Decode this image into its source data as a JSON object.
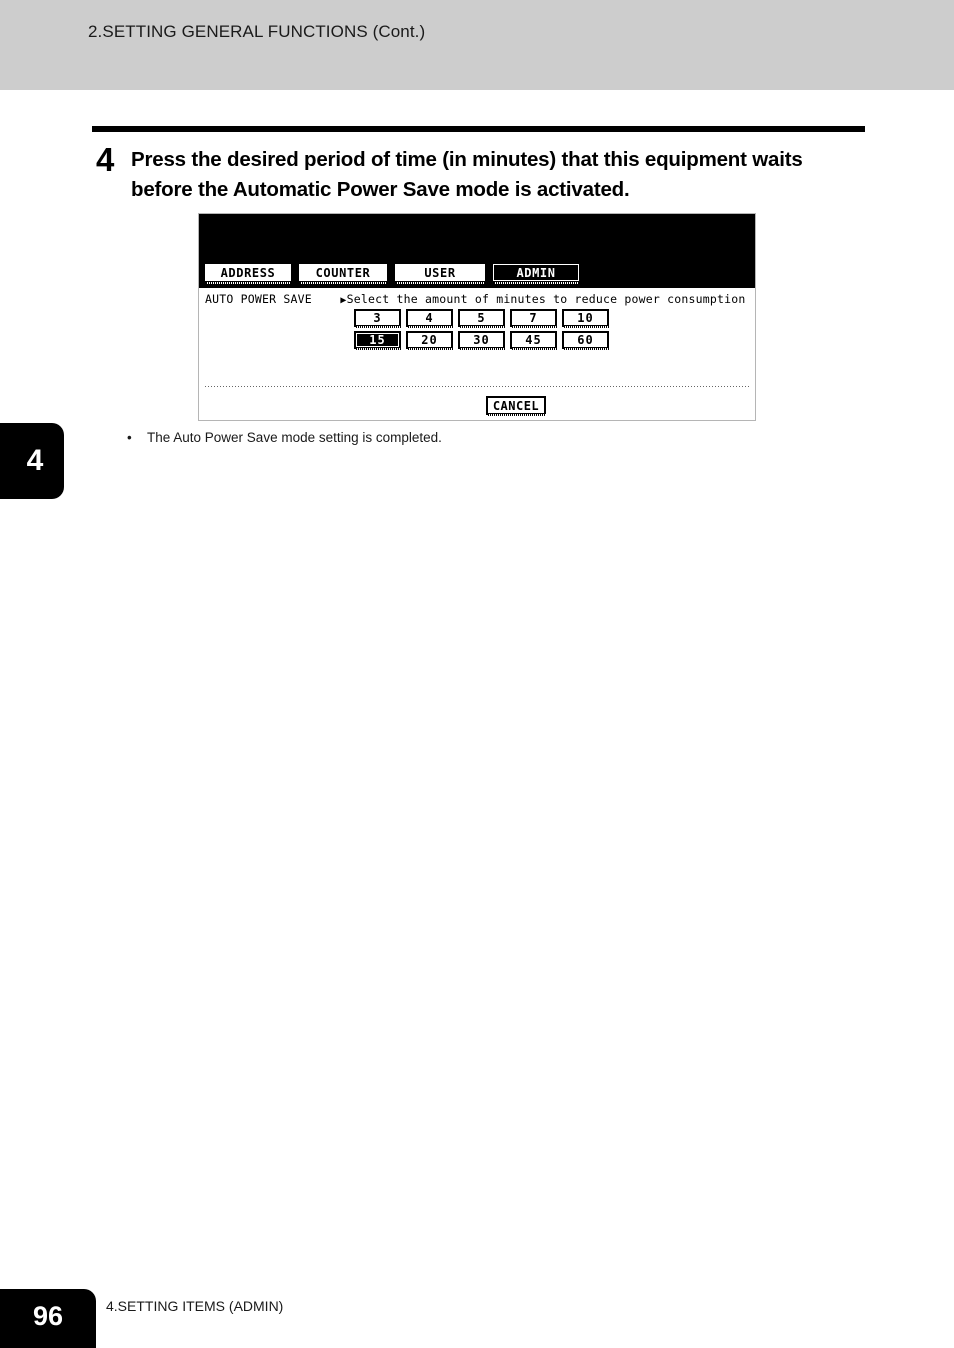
{
  "header": {
    "title": "2.SETTING GENERAL FUNCTIONS (Cont.)"
  },
  "step": {
    "number": "4",
    "text": "Press the desired period of time (in minutes) that this equipment waits before the Automatic Power Save mode is activated."
  },
  "lcd": {
    "tabs": [
      {
        "label": "ADDRESS",
        "selected": false
      },
      {
        "label": "COUNTER",
        "selected": false
      },
      {
        "label": "USER",
        "selected": false
      },
      {
        "label": "ADMIN",
        "selected": true
      }
    ],
    "setting_name": "AUTO POWER SAVE",
    "arrow": "▶",
    "prompt": "Select the amount of minutes to reduce power consumption",
    "minute_rows": [
      [
        {
          "label": "3",
          "selected": false
        },
        {
          "label": "4",
          "selected": false
        },
        {
          "label": "5",
          "selected": false
        },
        {
          "label": "7",
          "selected": false
        },
        {
          "label": "10",
          "selected": false
        }
      ],
      [
        {
          "label": "15",
          "selected": true
        },
        {
          "label": "20",
          "selected": false
        },
        {
          "label": "30",
          "selected": false
        },
        {
          "label": "45",
          "selected": false
        },
        {
          "label": "60",
          "selected": false
        }
      ]
    ],
    "cancel_label": "CANCEL"
  },
  "note": {
    "bullet": "•",
    "text": "The Auto Power Save mode setting is completed."
  },
  "chapter_tab": {
    "number": "4"
  },
  "footer": {
    "page_number": "96",
    "section": "4.SETTING ITEMS (ADMIN)"
  }
}
